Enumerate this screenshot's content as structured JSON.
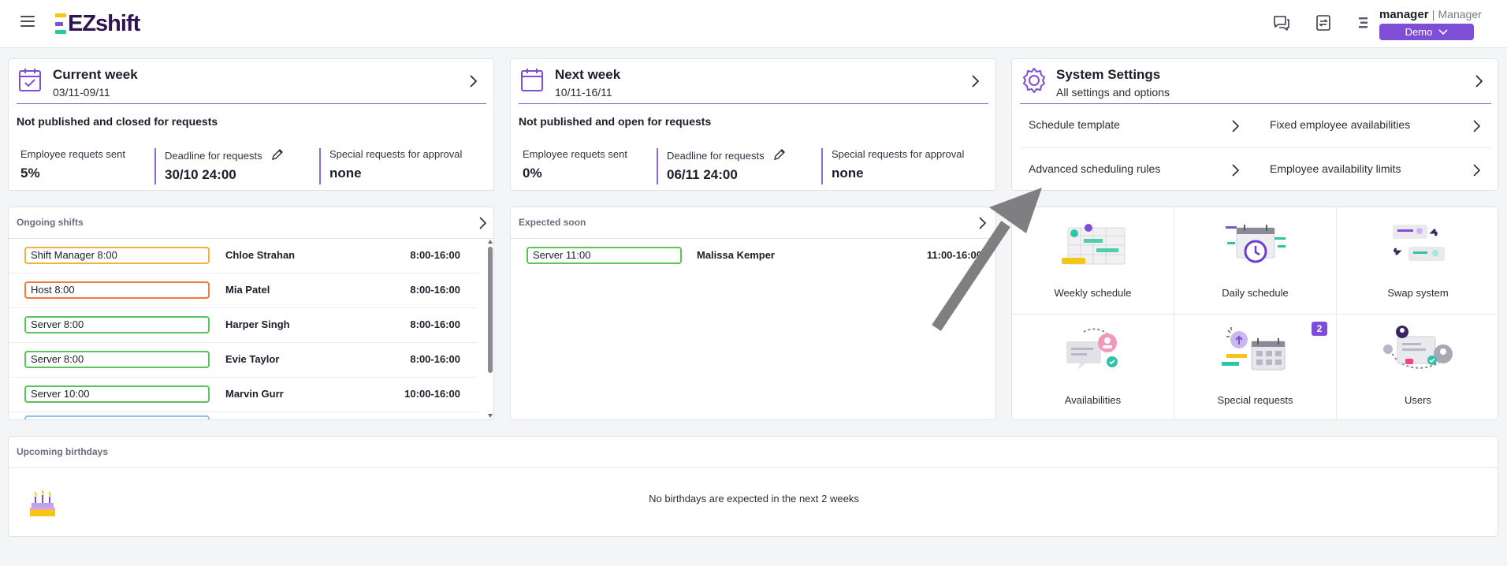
{
  "header": {
    "logo_text": "EZshift",
    "user_name": "manager",
    "separator": "|",
    "user_role": "Manager",
    "location_button": "Demo"
  },
  "current_week": {
    "title": "Current week",
    "range": "03/11-09/11",
    "status": "Not published and closed for requests",
    "stats": [
      {
        "label": "Employee requets sent",
        "value": "5%"
      },
      {
        "label": "Deadline for requests",
        "value": "30/10 24:00"
      },
      {
        "label": "Special requests for approval",
        "value": "none"
      }
    ]
  },
  "next_week": {
    "title": "Next week",
    "range": "10/11-16/11",
    "status": "Not published and open for requests",
    "stats": [
      {
        "label": "Employee requets sent",
        "value": "0%"
      },
      {
        "label": "Deadline for requests",
        "value": "06/11 24:00"
      },
      {
        "label": "Special requests for approval",
        "value": "none"
      }
    ]
  },
  "system_settings": {
    "title": "System Settings",
    "subtitle": "All settings and options",
    "links": [
      "Schedule template",
      "Fixed employee availabilities",
      "Advanced scheduling rules",
      "Employee availability limits"
    ]
  },
  "ongoing_shifts": {
    "title": "Ongoing shifts",
    "rows": [
      {
        "shift": "Shift Manager 8:00",
        "name": "Chloe Strahan",
        "time": "8:00-16:00",
        "color": "#f0b43c"
      },
      {
        "shift": "Host 8:00",
        "name": "Mia Patel",
        "time": "8:00-16:00",
        "color": "#f07a3c"
      },
      {
        "shift": "Server 8:00",
        "name": "Harper Singh",
        "time": "8:00-16:00",
        "color": "#5cc25a"
      },
      {
        "shift": "Server 8:00",
        "name": "Evie Taylor",
        "time": "8:00-16:00",
        "color": "#5cc25a"
      },
      {
        "shift": "Server 10:00",
        "name": "Marvin Gurr",
        "time": "10:00-16:00",
        "color": "#5cc25a"
      }
    ]
  },
  "expected_soon": {
    "title": "Expected soon",
    "rows": [
      {
        "shift": "Server 11:00",
        "name": "Malissa Kemper",
        "time": "11:00-16:00",
        "color": "#5cc25a"
      }
    ]
  },
  "modules": {
    "tiles": [
      "Weekly schedule",
      "Daily schedule",
      "Swap system",
      "Availabilities",
      "Special requests",
      "Users"
    ],
    "special_requests_badge": "2"
  },
  "birthdays": {
    "title": "Upcoming birthdays",
    "message": "No birthdays are expected in the next 2 weeks"
  },
  "colors": {
    "accent": "#7e4fd6",
    "rule": "#8d6ad9",
    "logo_yellow": "#f5c518",
    "logo_purple": "#7e4fd6",
    "logo_teal": "#2ec4a6"
  }
}
